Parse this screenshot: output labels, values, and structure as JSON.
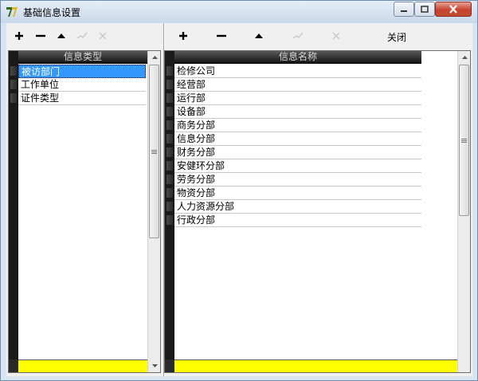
{
  "window": {
    "title": "基础信息设置",
    "icon": "app-logo-icon"
  },
  "toolbar_left": {
    "add_icon": "plus-icon",
    "remove_icon": "minus-icon",
    "up_icon": "triangle-up-icon",
    "post_icon": "check-icon",
    "cancel_icon": "cross-icon"
  },
  "toolbar_right": {
    "add_icon": "plus-icon",
    "remove_icon": "minus-icon",
    "up_icon": "triangle-up-icon",
    "post_icon": "check-icon",
    "cancel_icon": "cross-icon",
    "close_label": "关闭"
  },
  "left_grid": {
    "header": "信息类型",
    "rows": [
      "被访部门",
      "工作单位",
      "证件类型"
    ],
    "selected_index": 0
  },
  "right_grid": {
    "header": "信息名称",
    "rows": [
      "检修公司",
      "经营部",
      "运行部",
      "设备部",
      "商务分部",
      "信息分部",
      "财务分部",
      "安健环分部",
      "劳务分部",
      "物资分部",
      "人力资源分部",
      "行政分部"
    ]
  },
  "colors": {
    "selection": "#3399ff",
    "footer": "#ffff00",
    "header": "#151515"
  }
}
